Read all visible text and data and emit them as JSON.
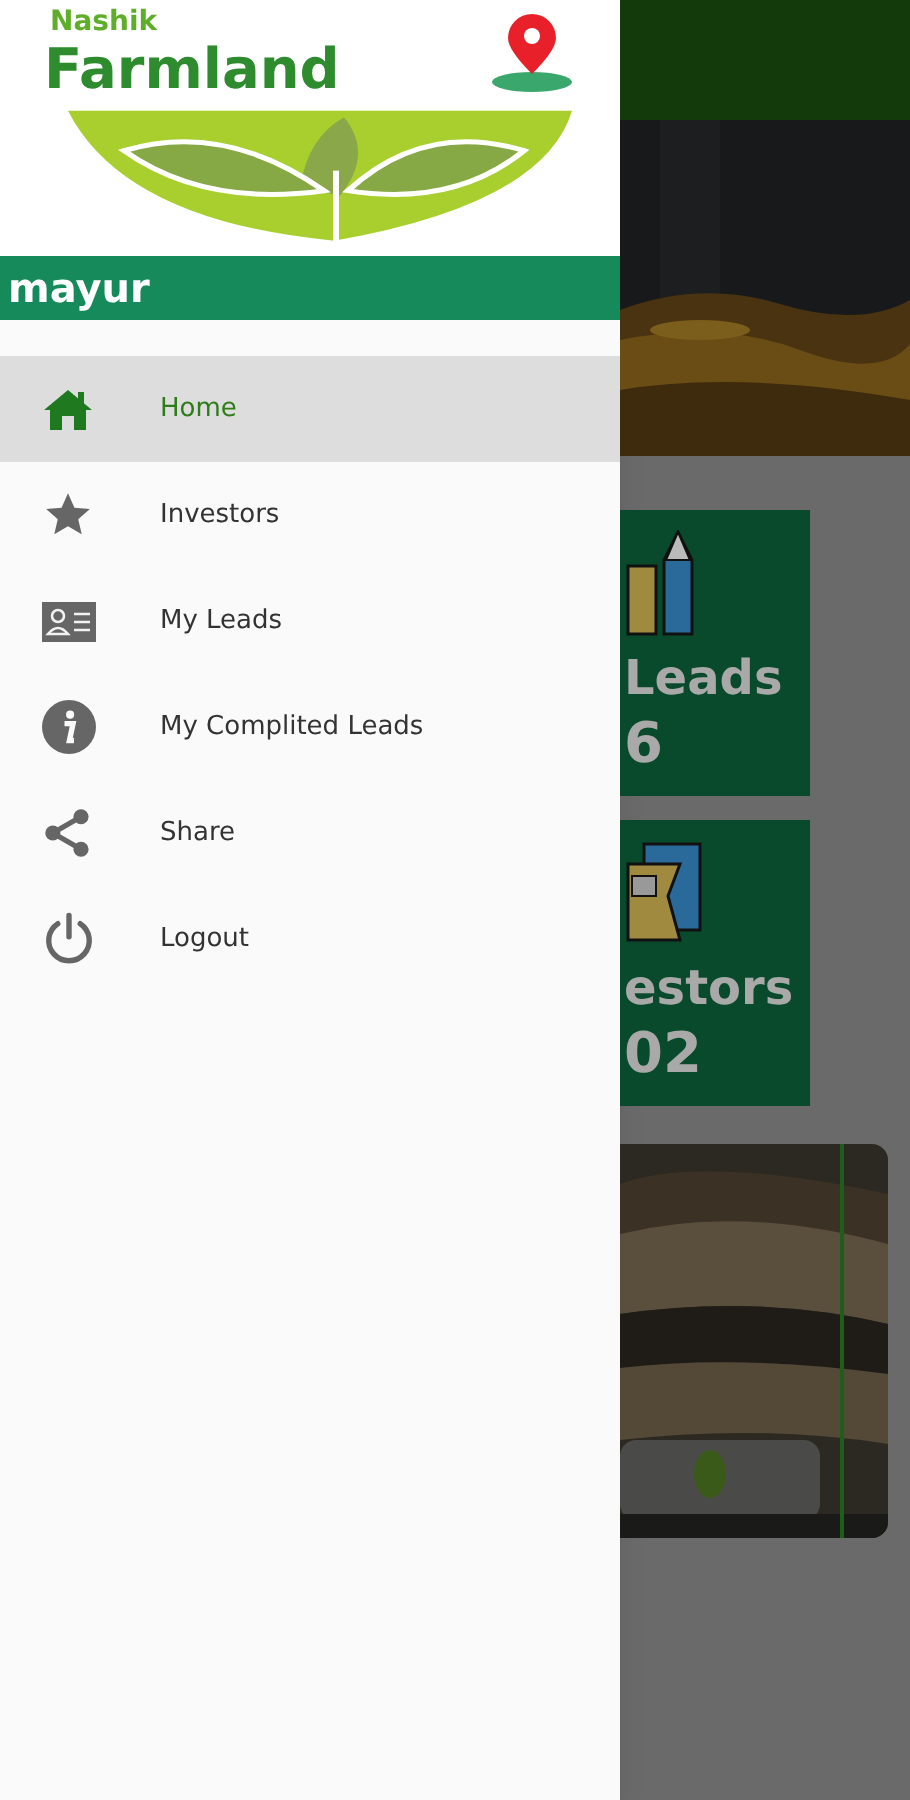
{
  "drawer": {
    "logo": {
      "line1": "Nashik",
      "line2": "Farmland"
    },
    "user_name": "mayur",
    "menu": [
      {
        "label": "Home",
        "selected": true
      },
      {
        "label": "Investors",
        "selected": false
      },
      {
        "label": "My Leads",
        "selected": false
      },
      {
        "label": "My Complited Leads",
        "selected": false
      },
      {
        "label": "Share",
        "selected": false
      },
      {
        "label": "Logout",
        "selected": false
      }
    ]
  },
  "dashboard": {
    "cards": [
      {
        "title": "Leads",
        "count": "6"
      },
      {
        "title": "estors",
        "count": "02"
      }
    ]
  }
}
